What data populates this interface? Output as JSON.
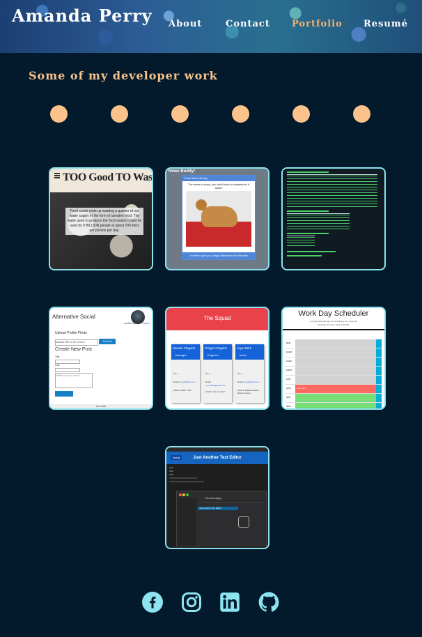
{
  "header": {
    "brand": "Amanda Perry",
    "nav": [
      {
        "label": "About"
      },
      {
        "label": "Contact"
      },
      {
        "label": "Portfolio",
        "active": true
      },
      {
        "label": "Resumé"
      }
    ]
  },
  "section_title": "Some of my developer work",
  "dot_count": 6,
  "projects": [
    {
      "title": "TOO Good TO Waste",
      "text": "Food waste ends up wasting a quarter of our water supply in the form of uneaten food. The water used to produce the food wasted could be used by 9 BILLION people at about 200 liters per person per day."
    },
    {
      "title": "News Buddy!",
      "modal_title": "Front News Buddy",
      "modal_text": "The news is scary, you don't have to experience it alone!",
      "footer": "I'm here to give you a happy distraction from the news"
    },
    {
      "title": "Command line employee tracker"
    },
    {
      "title": "Alternative Social",
      "upload_label": "Upload Profile Photo",
      "choose_file": "Choose File",
      "no_file": "No file chosen",
      "submit": "Submit",
      "create_post": "Create New Post",
      "title_label": "Title",
      "link_label": "Link",
      "post_placeholder": "What's on your mind?",
      "user": "southernperry",
      "logout": "logout",
      "footer": "Alt social"
    },
    {
      "title": "The Squad",
      "members": [
        {
          "name": "Sandor Clegane",
          "role": "Manager",
          "id": "ID: 1",
          "email_label": "Email:",
          "email": "sandor@tim.com",
          "extra": "Office number: 103"
        },
        {
          "name": "Gregor Clegane",
          "role": "Engineer",
          "id": "ID: 2",
          "email_label": "Email:",
          "email": "mountain@gmail.com",
          "extra": "GitHub: the mountain"
        },
        {
          "name": "Arya Stark",
          "role": "Intern",
          "id": "ID: 3",
          "email_label": "Email:",
          "email": "arya@gmail.com",
          "extra": "School: Braavos Water Dance School"
        }
      ]
    },
    {
      "title": "Work Day Scheduler",
      "subtitle": "A simple calendar app for scheduling your work day",
      "date": "Monday, June 21, 2021, 1:52 PM",
      "hours": [
        "9AM",
        "10AM",
        "11AM",
        "12PM",
        "1PM",
        "2PM",
        "3PM",
        "4PM",
        "5PM"
      ],
      "event": "Call client"
    },
    {
      "title": "Just Another Text Editor",
      "window_title": "Just Another Text Editor",
      "install": "Install",
      "app_drawer": "Chrome Apps",
      "app_item": "Just Another Text Editor"
    }
  ],
  "social": [
    {
      "name": "facebook"
    },
    {
      "name": "instagram"
    },
    {
      "name": "linkedin"
    },
    {
      "name": "github"
    }
  ],
  "colors": {
    "background": "#021a2b",
    "accent": "#f7b26f",
    "card_border": "#8de3f0",
    "icon": "#8de3f0"
  }
}
